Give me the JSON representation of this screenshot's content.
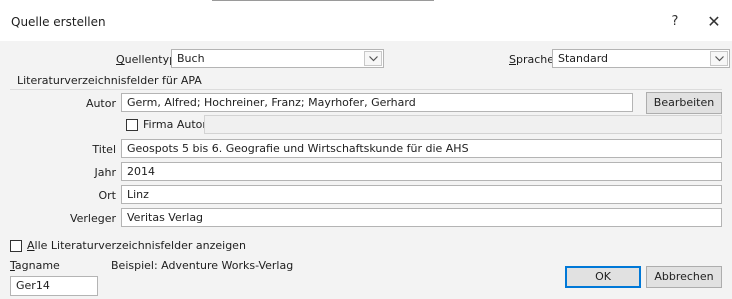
{
  "window": {
    "title": "Quelle erstellen",
    "help_glyph": "?",
    "close_glyph": "✕"
  },
  "source_type": {
    "label_first": "Q",
    "label_rest": "uellentyp",
    "value": "Buch"
  },
  "language": {
    "label_first": "S",
    "label_rest": "prache",
    "value": "Standard"
  },
  "group_title": "Literaturverzeichnisfelder für APA",
  "author": {
    "label": "Autor",
    "value": "Germ, Alfred; Hochreiner, Franz; Mayrhofer, Gerhard",
    "edit_button": "Bearbeiten"
  },
  "corporate_author": {
    "label": "Firma Autor",
    "checked": false,
    "value": ""
  },
  "title_field": {
    "label": "Titel",
    "value": "Geospots 5 bis 6. Geografie und Wirtschaftskunde für die AHS"
  },
  "year": {
    "label": "Jahr",
    "value": "2014"
  },
  "city": {
    "label": "Ort",
    "value": "Linz"
  },
  "publisher": {
    "label": "Verleger",
    "value": "Veritas Verlag"
  },
  "show_all": {
    "label_first": "A",
    "label_rest": "lle Literaturverzeichnisfelder anzeigen",
    "checked": false
  },
  "tag_name": {
    "label_first": "T",
    "label_rest": "agname",
    "value": "Ger14",
    "example": "Beispiel: Adventure Works-Verlag"
  },
  "buttons": {
    "ok": "OK",
    "cancel": "Abbrechen"
  }
}
